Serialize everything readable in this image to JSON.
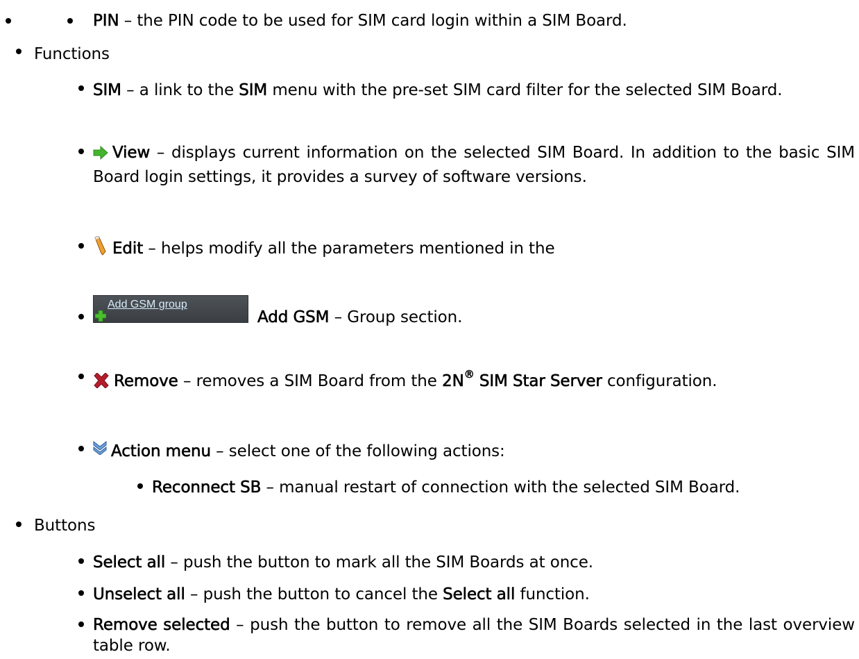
{
  "pin_item": {
    "term": "PIN",
    "rest": " – the PIN code to be used for SIM card login within a SIM Board."
  },
  "functions": {
    "heading": "Functions",
    "sim": {
      "term": "SIM",
      "part1": " – a link to the ",
      "term2": "SIM",
      "part2": " menu with the pre-set SIM card filter for the selected SIM Board."
    },
    "view": {
      "icon": "green-arrow-icon",
      "term": "View",
      "rest": " – displays current information on the selected SIM Board. In addition to the basic SIM Board login settings, it provides a survey of software versions."
    },
    "edit": {
      "icon": "pencil-icon",
      "term": "Edit",
      "rest": " – helps modify all the parameters mentioned in the"
    },
    "add_gsm": {
      "button_label": "Add GSM group",
      "term": "Add GSM",
      "rest": " – Group section."
    },
    "remove": {
      "icon": "red-cross-icon",
      "term": "Remove",
      "part1": " – removes a SIM Board from the ",
      "brand": "2N",
      "reg": "®",
      "brand_rest": " SIM Star Server",
      "part2": " configuration."
    },
    "action_menu": {
      "icon": "double-chevron-down-icon",
      "term": "Action menu",
      "rest": " – select one of the following actions:",
      "reconnect": {
        "term": "Reconnect SB",
        "rest": " – manual restart of connection with the selected SIM Board."
      }
    }
  },
  "buttons": {
    "heading": "Buttons",
    "select_all": {
      "term": "Select all",
      "rest": " – push the button to mark all the SIM Boards at once."
    },
    "unselect_all": {
      "term": "Unselect all",
      "part1": " – push the button to cancel the ",
      "term2": "Select all",
      "part2": " function."
    },
    "remove_selected": {
      "term": "Remove selected",
      "rest": " – push the button to remove all the SIM Boards selected in the last overview table row."
    }
  },
  "colors": {
    "button_bg": "#44484d",
    "button_link": "#d7ecfb",
    "arrow": "#44b52c",
    "cross": "#b51d2c",
    "chevron": "#6e9fd8"
  }
}
